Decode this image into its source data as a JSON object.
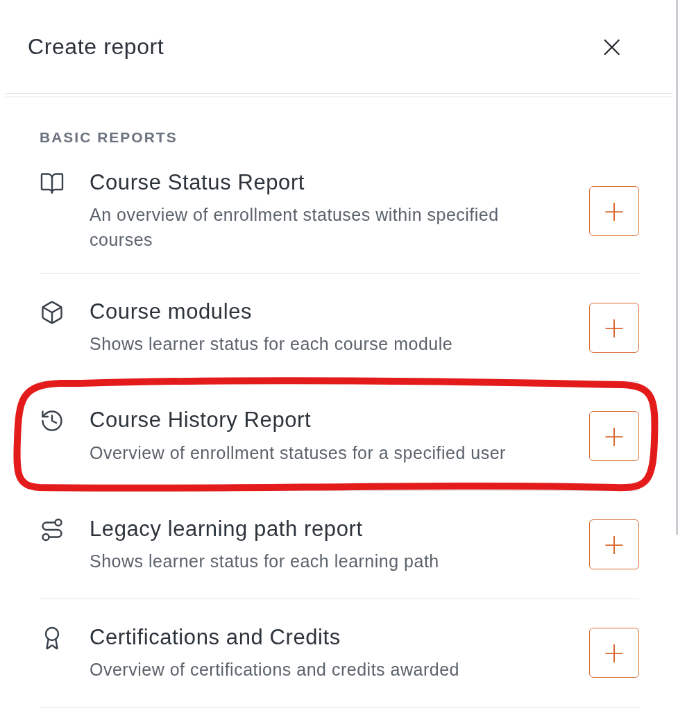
{
  "dialog": {
    "title": "Create report",
    "close_label": "×"
  },
  "section": {
    "heading": "BASIC REPORTS"
  },
  "reports": [
    {
      "kind": "book",
      "title": "Course Status Report",
      "description": "An overview of enrollment statuses within specified courses",
      "add_label": "+",
      "highlighted": false
    },
    {
      "kind": "cube",
      "title": "Course modules",
      "description": "Shows learner status for each course module",
      "add_label": "+",
      "highlighted": false
    },
    {
      "kind": "history",
      "title": "Course History Report",
      "description": "Overview of enrollment statuses for a specified user",
      "add_label": "+",
      "highlighted": true
    },
    {
      "kind": "route",
      "title": "Legacy learning path report",
      "description": "Shows learner status for each learning path",
      "add_label": "+",
      "highlighted": false
    },
    {
      "kind": "award",
      "title": "Certifications and Credits",
      "description": "Overview of certifications and credits awarded",
      "add_label": "+",
      "highlighted": false
    }
  ]
}
